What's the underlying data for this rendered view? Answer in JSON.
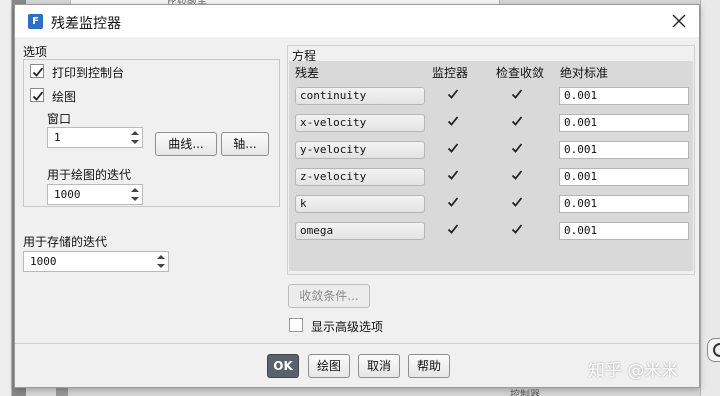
{
  "background": {
    "top_text": "比较敞羊",
    "bottom_text": "控制器"
  },
  "dialog": {
    "icon_letter": "F",
    "title": "残差监控器"
  },
  "options": {
    "group_label": "选项",
    "print_to_console": {
      "label": "打印到控制台",
      "checked": true
    },
    "plot": {
      "label": "绘图",
      "checked": true
    },
    "window_label": "窗口",
    "window_value": "1",
    "curves_button": "曲线...",
    "axes_button": "轴...",
    "plot_iterations_label": "用于绘图的迭代",
    "plot_iterations_value": "1000"
  },
  "storage": {
    "label": "用于存储的迭代",
    "value": "1000"
  },
  "equations": {
    "group_label": "方程",
    "columns": [
      "残差",
      "监控器",
      "检查收敛",
      "绝对标准"
    ],
    "rows": [
      {
        "residual": "continuity",
        "monitor": true,
        "check": true,
        "tolerance": "0.001"
      },
      {
        "residual": "x-velocity",
        "monitor": true,
        "check": true,
        "tolerance": "0.001"
      },
      {
        "residual": "y-velocity",
        "monitor": true,
        "check": true,
        "tolerance": "0.001"
      },
      {
        "residual": "z-velocity",
        "monitor": true,
        "check": true,
        "tolerance": "0.001"
      },
      {
        "residual": "k",
        "monitor": true,
        "check": true,
        "tolerance": "0.001"
      },
      {
        "residual": "omega",
        "monitor": true,
        "check": true,
        "tolerance": "0.001"
      }
    ]
  },
  "convergence_button": "收敛条件...",
  "advanced": {
    "label": "显示高级选项",
    "checked": false
  },
  "footer": {
    "ok": "OK",
    "plot": "绘图",
    "cancel": "取消",
    "help": "帮助"
  },
  "watermark": "知乎 @米米",
  "colors": {
    "accent": "#2d6fc4",
    "primary_button": "#59616a"
  }
}
